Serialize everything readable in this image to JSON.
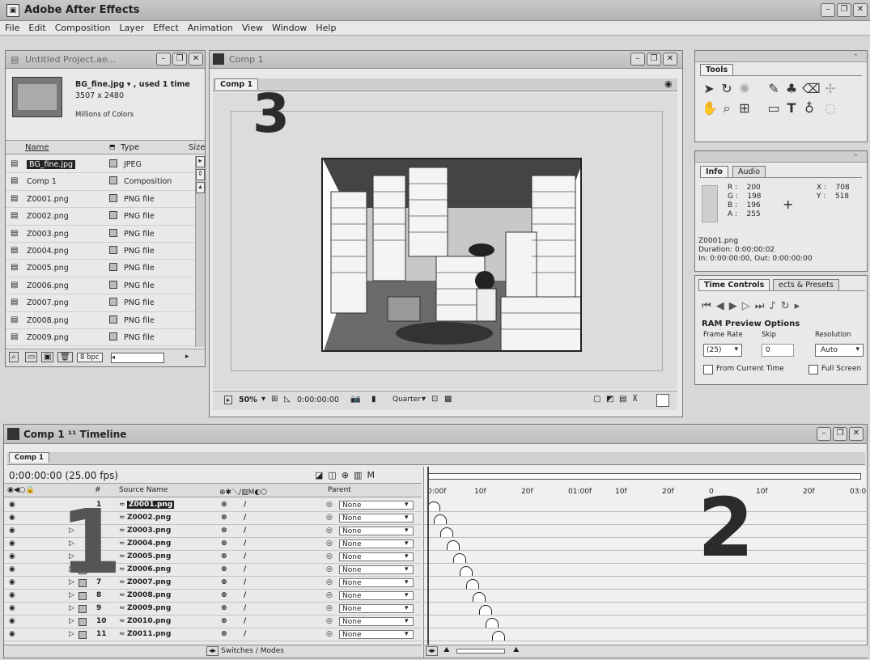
{
  "app": {
    "title": "Adobe After Effects",
    "menu": [
      "File",
      "Edit",
      "Composition",
      "Layer",
      "Effect",
      "Animation",
      "View",
      "Window",
      "Help"
    ]
  },
  "project": {
    "window_title": "Untitled Project.ae...",
    "preview_name": "BG_fine.jpg ▾ , used 1 time",
    "preview_size": "3507 x 2480",
    "preview_colors": "Millions of Colors",
    "columns": [
      "Name",
      "Type",
      "Size"
    ],
    "items": [
      {
        "name": "BG_fine.jpg",
        "type": "JPEG"
      },
      {
        "name": "Comp 1",
        "type": "Composition"
      },
      {
        "name": "Z0001.png",
        "type": "PNG file"
      },
      {
        "name": "Z0002.png",
        "type": "PNG file"
      },
      {
        "name": "Z0003.png",
        "type": "PNG file"
      },
      {
        "name": "Z0004.png",
        "type": "PNG file"
      },
      {
        "name": "Z0005.png",
        "type": "PNG file"
      },
      {
        "name": "Z0006.png",
        "type": "PNG file"
      },
      {
        "name": "Z0007.png",
        "type": "PNG file"
      },
      {
        "name": "Z0008.png",
        "type": "PNG file"
      },
      {
        "name": "Z0009.png",
        "type": "PNG file"
      }
    ],
    "bpc": "8 bpc"
  },
  "comp": {
    "window_title": "Comp 1",
    "tab": "Comp 1",
    "zoom": "50%",
    "timecode": "0:00:00:00",
    "resolution": "Quarter"
  },
  "tools": {
    "title": "Tools"
  },
  "info": {
    "tabs": [
      "Info",
      "Audio"
    ],
    "r": "200",
    "g": "198",
    "b": "196",
    "a": "255",
    "x": "708",
    "y": "518",
    "file": "Z0001.png",
    "duration": "Duration: 0:00:00:02",
    "inout": "In: 0:00:00:00, Out: 0:00:00:00"
  },
  "time_controls": {
    "tabs": [
      "Time Controls",
      "ects & Presets"
    ],
    "ram_title": "RAM Preview Options",
    "frame_rate_label": "Frame Rate",
    "skip_label": "Skip",
    "resolution_label": "Resolution",
    "frame_rate": "(25)",
    "skip": "0",
    "resolution": "Auto",
    "from_current": "From Current Time",
    "full_screen": "Full Screen"
  },
  "timeline": {
    "title": "Comp 1 ¹¹ Timeline",
    "tab": "Comp 1",
    "timecode": "0:00:00:00 (25.00 fps)",
    "col_source": "Source Name",
    "col_parent": "Parent",
    "ruler": [
      "0:00f",
      "10f",
      "20f",
      "01:00f",
      "10f",
      "20f",
      "0",
      "10f",
      "20f",
      "03:0"
    ],
    "switches": "Switches / Modes",
    "layers": [
      {
        "n": "1",
        "name": "Z0001.png",
        "parent": "None"
      },
      {
        "n": "2",
        "name": "Z0002.png",
        "parent": "None"
      },
      {
        "n": "3",
        "name": "Z0003.png",
        "parent": "None"
      },
      {
        "n": "4",
        "name": "Z0004.png",
        "parent": "None"
      },
      {
        "n": "5",
        "name": "Z0005.png",
        "parent": "None"
      },
      {
        "n": "6",
        "name": "Z0006.png",
        "parent": "None"
      },
      {
        "n": "7",
        "name": "Z0007.png",
        "parent": "None"
      },
      {
        "n": "8",
        "name": "Z0008.png",
        "parent": "None"
      },
      {
        "n": "9",
        "name": "Z0009.png",
        "parent": "None"
      },
      {
        "n": "10",
        "name": "Z0010.png",
        "parent": "None"
      },
      {
        "n": "11",
        "name": "Z0011.png",
        "parent": "None"
      }
    ]
  },
  "callouts": [
    "1",
    "2",
    "3"
  ]
}
